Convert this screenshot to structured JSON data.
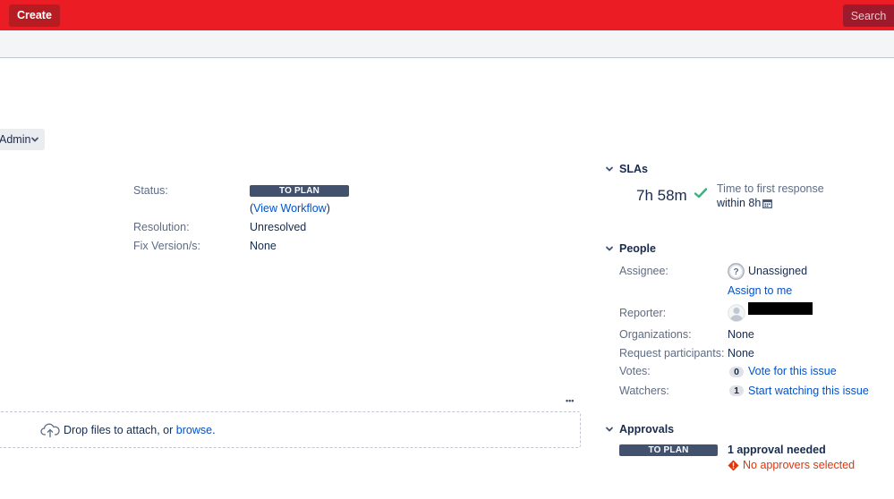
{
  "topbar": {
    "create_label": "Create",
    "search_label": "Search"
  },
  "toolbar": {
    "admin_label": "Admin"
  },
  "details": {
    "status_label": "Status:",
    "status_value": "TO PLAN",
    "view_workflow_open": "(",
    "view_workflow_link": "View Workflow",
    "view_workflow_close": ")",
    "resolution_label": "Resolution:",
    "resolution_value": "Unresolved",
    "fix_version_label": "Fix Version/s:",
    "fix_version_value": "None"
  },
  "attachments": {
    "more_label": "•••",
    "drop_text": "Drop files to attach, or ",
    "browse_link": "browse",
    "period": "."
  },
  "slas": {
    "heading": "SLAs",
    "time": "7h 58m",
    "name": "Time to first response",
    "target": "within 8h"
  },
  "people": {
    "heading": "People",
    "assignee_label": "Assignee:",
    "assignee_value": "Unassigned",
    "assign_to_me": "Assign to me",
    "reporter_label": "Reporter:",
    "organizations_label": "Organizations:",
    "organizations_value": "None",
    "participants_label": "Request participants:",
    "participants_value": "None",
    "votes_label": "Votes:",
    "votes_count": "0",
    "votes_link": "Vote for this issue",
    "watchers_label": "Watchers:",
    "watchers_count": "1",
    "watchers_link": "Start watching this issue"
  },
  "approvals": {
    "heading": "Approvals",
    "status": "TO PLAN",
    "needed": "1 approval needed",
    "warning": "No approvers selected"
  },
  "colors": {
    "brand": "#ec1c24",
    "link": "#0052cc",
    "lozenge": "#42526e",
    "success": "#36b37e",
    "error": "#de350b"
  },
  "icons": [
    "chevron-down-icon",
    "cloud-upload-icon",
    "check-icon",
    "calendar-icon",
    "unknown-user-icon",
    "user-avatar-icon",
    "warning-icon"
  ]
}
